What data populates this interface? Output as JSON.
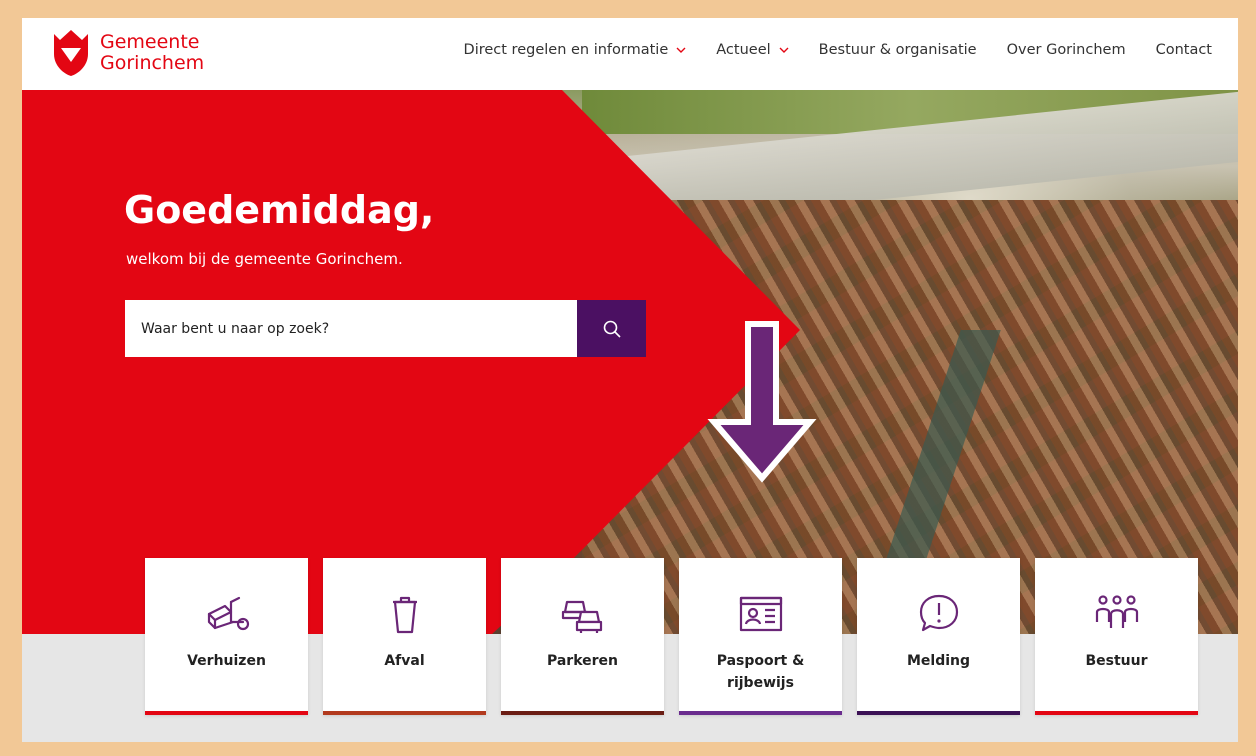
{
  "brand": {
    "name_line1": "Gemeente",
    "name_line2": "Gorinchem",
    "color": "#e30613"
  },
  "nav": {
    "items": [
      {
        "label": "Direct regelen en informatie",
        "has_dropdown": true
      },
      {
        "label": "Actueel",
        "has_dropdown": true
      },
      {
        "label": "Bestuur & organisatie",
        "has_dropdown": false
      },
      {
        "label": "Over Gorinchem",
        "has_dropdown": false
      },
      {
        "label": "Contact",
        "has_dropdown": false
      }
    ]
  },
  "hero": {
    "greeting": "Goedemiddag,",
    "welcome": "welkom bij de gemeente Gorinchem.",
    "search_placeholder": "Waar bent u naar op zoek?",
    "search_icon": "search-icon",
    "search_button_color": "#4b1062"
  },
  "tiles": [
    {
      "label": "Verhuizen",
      "icon": "moving-truck-icon",
      "bar_color": "#e30613"
    },
    {
      "label": "Afval",
      "icon": "trash-bin-icon",
      "bar_color": "#b23a1e"
    },
    {
      "label": "Parkeren",
      "icon": "cars-icon",
      "bar_color": "#6b1d14"
    },
    {
      "label": "Paspoort & rijbewijs",
      "icon": "id-card-icon",
      "bar_color": "#6a2c8e"
    },
    {
      "label": "Melding",
      "icon": "alert-speech-icon",
      "bar_color": "#3b1155"
    },
    {
      "label": "Bestuur",
      "icon": "people-icon",
      "bar_color": "#e30613"
    }
  ],
  "annotation": {
    "icon": "down-arrow-icon",
    "color": "#6a2677"
  }
}
